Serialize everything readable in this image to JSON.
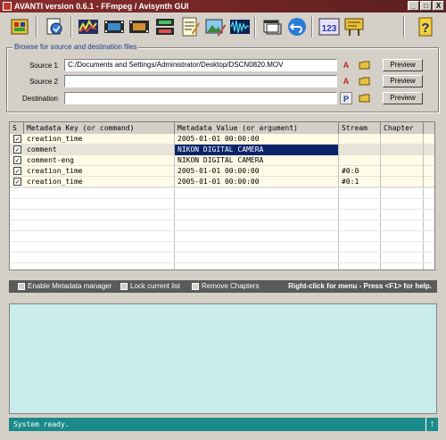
{
  "window": {
    "title": "AVANTI version 0.6.1 - FFmpeg / Avisynth GUI",
    "minimize_label": "_",
    "maximize_label": "□",
    "close_label": "X"
  },
  "toolbar": {
    "buttons": [
      {
        "icon": "job-manager-icon"
      },
      {
        "icon": "batch-icon"
      },
      {
        "icon": "audio-graph-icon"
      },
      {
        "icon": "film-icon"
      },
      {
        "icon": "film-edit-icon"
      },
      {
        "icon": "film-stack-icon"
      },
      {
        "icon": "notepad-icon"
      },
      {
        "icon": "image-edit-icon"
      },
      {
        "icon": "waveform-icon"
      },
      {
        "icon": "window-icon"
      },
      {
        "icon": "undo-icon"
      },
      {
        "icon": "counter-icon"
      },
      {
        "icon": "sign-icon"
      },
      {
        "icon": "help-icon"
      }
    ]
  },
  "files": {
    "group_title": "Browse for source and destination files",
    "rows": [
      {
        "label": "Source 1",
        "value": "C:/Documents and Settings/Administrator/Desktop/DSCN0820.MOV",
        "button": "Preview"
      },
      {
        "label": "Source 2",
        "value": "",
        "button": "Preview"
      },
      {
        "label": "Destination",
        "value": "",
        "button": "Preview"
      }
    ],
    "avisynth_glyph": "A",
    "p_glyph": "P"
  },
  "metadata_table": {
    "columns": [
      "S",
      "Metadata Key (or command)",
      "Metadata Value (or argument)",
      "Stream",
      "Chapter"
    ],
    "rows": [
      {
        "checked": true,
        "key": "creation_time",
        "value": "2005-01-01 00:00:00",
        "stream": "",
        "chapter": "",
        "selected": false
      },
      {
        "checked": true,
        "key": "comment",
        "value": "NIKON DIGITAL CAMERA",
        "stream": "",
        "chapter": "",
        "selected": true
      },
      {
        "checked": true,
        "key": "comment-eng",
        "value": "NIKON DIGITAL CAMERA",
        "stream": "",
        "chapter": "",
        "selected": false
      },
      {
        "checked": true,
        "key": "creation_time",
        "value": "2005-01-01 00:00:00",
        "stream": "#0:0",
        "chapter": "",
        "selected": false
      },
      {
        "checked": true,
        "key": "creation_time",
        "value": "2005-01-01 00:00:00",
        "stream": "#0:1",
        "chapter": "",
        "selected": false
      }
    ],
    "check_glyph": "✓"
  },
  "options": {
    "enable_metadata": "Enable Metadata manager",
    "lock_list": "Lock current list",
    "remove_chapters": "Remove Chapters",
    "hint": "Right-click for menu - Press <F1> for help."
  },
  "status": {
    "text": "System ready.",
    "arrow": "↑"
  },
  "colors": {
    "title_bar": "#8a2d2d",
    "selected_row": "#0a246a",
    "log_background": "#c8ecec",
    "status_bar": "#1a8a8a"
  }
}
